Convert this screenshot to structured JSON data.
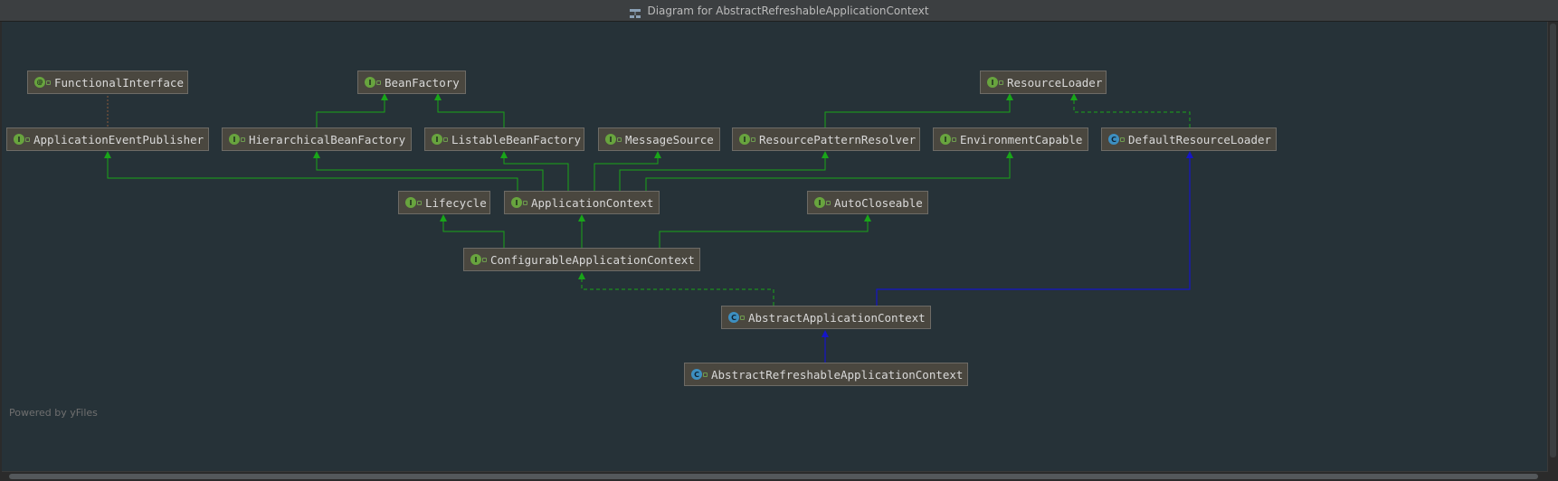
{
  "window": {
    "title": "Diagram for AbstractRefreshableApplicationContext",
    "title_icon": "diagram-icon"
  },
  "footer": {
    "powered_by": "Powered by yFiles"
  },
  "colors": {
    "background": "#263238",
    "node_fill": "#4a473f",
    "interface_extends_edge": "#19a519",
    "class_extends_edge": "#1515c8",
    "implements_edge": "#19a519",
    "interface_badge": "#68a43e",
    "class_badge": "#3d8fc1"
  },
  "nodes": [
    {
      "id": "FunctionalInterface",
      "label": "FunctionalInterface",
      "kind": "annotation",
      "icon": "annotation-icon"
    },
    {
      "id": "BeanFactory",
      "label": "BeanFactory",
      "kind": "interface",
      "icon": "interface-icon"
    },
    {
      "id": "ResourceLoader",
      "label": "ResourceLoader",
      "kind": "interface",
      "icon": "interface-icon"
    },
    {
      "id": "ApplicationEventPublisher",
      "label": "ApplicationEventPublisher",
      "kind": "interface",
      "icon": "interface-icon"
    },
    {
      "id": "HierarchicalBeanFactory",
      "label": "HierarchicalBeanFactory",
      "kind": "interface",
      "icon": "interface-icon"
    },
    {
      "id": "ListableBeanFactory",
      "label": "ListableBeanFactory",
      "kind": "interface",
      "icon": "interface-icon"
    },
    {
      "id": "MessageSource",
      "label": "MessageSource",
      "kind": "interface",
      "icon": "interface-icon"
    },
    {
      "id": "ResourcePatternResolver",
      "label": "ResourcePatternResolver",
      "kind": "interface",
      "icon": "interface-icon"
    },
    {
      "id": "EnvironmentCapable",
      "label": "EnvironmentCapable",
      "kind": "interface",
      "icon": "interface-icon"
    },
    {
      "id": "DefaultResourceLoader",
      "label": "DefaultResourceLoader",
      "kind": "class",
      "icon": "class-icon"
    },
    {
      "id": "Lifecycle",
      "label": "Lifecycle",
      "kind": "interface",
      "icon": "interface-icon"
    },
    {
      "id": "ApplicationContext",
      "label": "ApplicationContext",
      "kind": "interface",
      "icon": "interface-icon"
    },
    {
      "id": "AutoCloseable",
      "label": "AutoCloseable",
      "kind": "interface",
      "icon": "interface-icon"
    },
    {
      "id": "ConfigurableApplicationContext",
      "label": "ConfigurableApplicationContext",
      "kind": "interface",
      "icon": "interface-icon"
    },
    {
      "id": "AbstractApplicationContext",
      "label": "AbstractApplicationContext",
      "kind": "abstract-class",
      "icon": "abstract-class-icon"
    },
    {
      "id": "AbstractRefreshableApplicationContext",
      "label": "AbstractRefreshableApplicationContext",
      "kind": "abstract-class",
      "icon": "abstract-class-icon"
    }
  ],
  "edges": [
    {
      "from": "ApplicationEventPublisher",
      "to": "FunctionalInterface",
      "type": "annotated"
    },
    {
      "from": "HierarchicalBeanFactory",
      "to": "BeanFactory",
      "type": "extends"
    },
    {
      "from": "ListableBeanFactory",
      "to": "BeanFactory",
      "type": "extends"
    },
    {
      "from": "ResourcePatternResolver",
      "to": "ResourceLoader",
      "type": "extends"
    },
    {
      "from": "DefaultResourceLoader",
      "to": "ResourceLoader",
      "type": "implements"
    },
    {
      "from": "ApplicationContext",
      "to": "ApplicationEventPublisher",
      "type": "extends"
    },
    {
      "from": "ApplicationContext",
      "to": "HierarchicalBeanFactory",
      "type": "extends"
    },
    {
      "from": "ApplicationContext",
      "to": "ListableBeanFactory",
      "type": "extends"
    },
    {
      "from": "ApplicationContext",
      "to": "MessageSource",
      "type": "extends"
    },
    {
      "from": "ApplicationContext",
      "to": "ResourcePatternResolver",
      "type": "extends"
    },
    {
      "from": "ApplicationContext",
      "to": "EnvironmentCapable",
      "type": "extends"
    },
    {
      "from": "ConfigurableApplicationContext",
      "to": "Lifecycle",
      "type": "extends"
    },
    {
      "from": "ConfigurableApplicationContext",
      "to": "ApplicationContext",
      "type": "extends"
    },
    {
      "from": "ConfigurableApplicationContext",
      "to": "AutoCloseable",
      "type": "extends"
    },
    {
      "from": "AbstractApplicationContext",
      "to": "ConfigurableApplicationContext",
      "type": "implements"
    },
    {
      "from": "AbstractApplicationContext",
      "to": "DefaultResourceLoader",
      "type": "class-extends"
    },
    {
      "from": "AbstractRefreshableApplicationContext",
      "to": "AbstractApplicationContext",
      "type": "class-extends"
    }
  ]
}
